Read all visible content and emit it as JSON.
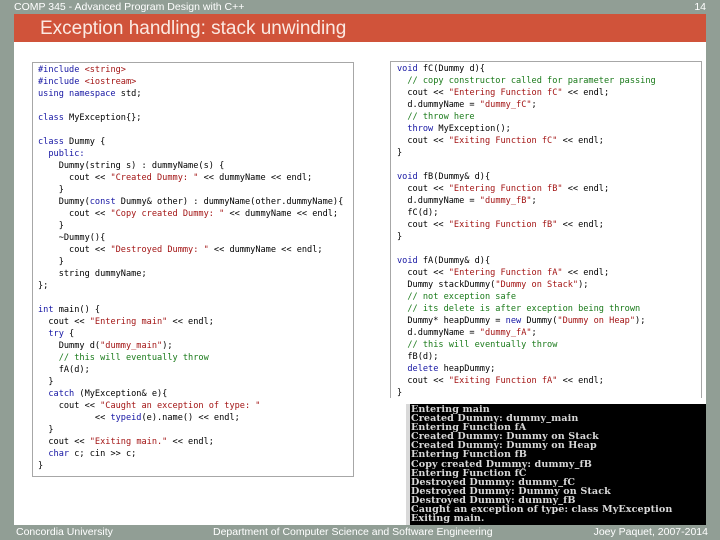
{
  "header": {
    "course_title": "COMP 345 - Advanced Program Design with C++",
    "slide_number": "14",
    "slide_title": "Exception handling: stack unwinding"
  },
  "colors": {
    "frame": "#919e95",
    "title_bar": "#d0533a",
    "keyword": "#1515a3",
    "string": "#a31515",
    "comment": "#1a7a1a",
    "terminal_bg": "#000000"
  },
  "left_code": {
    "lines": [
      [
        {
          "t": "#include ",
          "c": "pp"
        },
        {
          "t": "<string>",
          "c": "str"
        }
      ],
      [
        {
          "t": "#include ",
          "c": "pp"
        },
        {
          "t": "<iostream>",
          "c": "str"
        }
      ],
      [
        {
          "t": "using namespace ",
          "c": "kw"
        },
        {
          "t": "std;",
          "c": ""
        }
      ],
      [],
      [
        {
          "t": "class ",
          "c": "kw"
        },
        {
          "t": "MyException{};",
          "c": ""
        }
      ],
      [],
      [
        {
          "t": "class ",
          "c": "kw"
        },
        {
          "t": "Dummy {",
          "c": ""
        }
      ],
      [
        {
          "t": "  public:",
          "c": "kw"
        }
      ],
      [
        {
          "t": "    Dummy(string s) : dummyName(s) {",
          "c": ""
        }
      ],
      [
        {
          "t": "      cout << ",
          "c": ""
        },
        {
          "t": "\"Created Dummy: \"",
          "c": "str"
        },
        {
          "t": " << dummyName << endl;",
          "c": ""
        }
      ],
      [
        {
          "t": "    }",
          "c": ""
        }
      ],
      [
        {
          "t": "    Dummy(",
          "c": ""
        },
        {
          "t": "const",
          "c": "kw"
        },
        {
          "t": " Dummy& other) : dummyName(other.dummyName){",
          "c": ""
        }
      ],
      [
        {
          "t": "      cout << ",
          "c": ""
        },
        {
          "t": "\"Copy created Dummy: \"",
          "c": "str"
        },
        {
          "t": " << dummyName << endl;",
          "c": ""
        }
      ],
      [
        {
          "t": "    }",
          "c": ""
        }
      ],
      [
        {
          "t": "    ~Dummy(){",
          "c": ""
        }
      ],
      [
        {
          "t": "      cout << ",
          "c": ""
        },
        {
          "t": "\"Destroyed Dummy: \"",
          "c": "str"
        },
        {
          "t": " << dummyName << endl;",
          "c": ""
        }
      ],
      [
        {
          "t": "    }",
          "c": ""
        }
      ],
      [
        {
          "t": "    string dummyName;",
          "c": ""
        }
      ],
      [
        {
          "t": "};",
          "c": ""
        }
      ],
      [],
      [
        {
          "t": "int",
          "c": "kw"
        },
        {
          "t": " main() {",
          "c": ""
        }
      ],
      [
        {
          "t": "  cout << ",
          "c": ""
        },
        {
          "t": "\"Entering main\"",
          "c": "str"
        },
        {
          "t": " << endl;",
          "c": ""
        }
      ],
      [
        {
          "t": "  try",
          "c": "kw"
        },
        {
          "t": " {",
          "c": ""
        }
      ],
      [
        {
          "t": "    Dummy d(",
          "c": ""
        },
        {
          "t": "\"dummy_main\"",
          "c": "str"
        },
        {
          "t": ");",
          "c": ""
        }
      ],
      [
        {
          "t": "    // this will eventually throw",
          "c": "cm"
        }
      ],
      [
        {
          "t": "    fA(d);",
          "c": ""
        }
      ],
      [
        {
          "t": "  }",
          "c": ""
        }
      ],
      [
        {
          "t": "  catch",
          "c": "kw"
        },
        {
          "t": " (MyException& e){",
          "c": ""
        }
      ],
      [
        {
          "t": "    cout << ",
          "c": ""
        },
        {
          "t": "\"Caught an exception of type: \"",
          "c": "str"
        }
      ],
      [
        {
          "t": "           << ",
          "c": ""
        },
        {
          "t": "typeid",
          "c": "kw"
        },
        {
          "t": "(e).name() << endl;",
          "c": ""
        }
      ],
      [
        {
          "t": "  }",
          "c": ""
        }
      ],
      [
        {
          "t": "  cout << ",
          "c": ""
        },
        {
          "t": "\"Exiting main.\"",
          "c": "str"
        },
        {
          "t": " << endl;",
          "c": ""
        }
      ],
      [
        {
          "t": "  char",
          "c": "kw"
        },
        {
          "t": " c; cin >> c;",
          "c": ""
        }
      ],
      [
        {
          "t": "}",
          "c": ""
        }
      ]
    ]
  },
  "right_code": {
    "lines": [
      [
        {
          "t": "void",
          "c": "kw"
        },
        {
          "t": " fC(Dummy d){",
          "c": ""
        }
      ],
      [
        {
          "t": "  // copy constructor called for parameter passing",
          "c": "cm"
        }
      ],
      [
        {
          "t": "  cout << ",
          "c": ""
        },
        {
          "t": "\"Entering Function fC\"",
          "c": "str"
        },
        {
          "t": " << endl;",
          "c": ""
        }
      ],
      [
        {
          "t": "  d.dummyName = ",
          "c": ""
        },
        {
          "t": "\"dummy_fC\"",
          "c": "str"
        },
        {
          "t": ";",
          "c": ""
        }
      ],
      [
        {
          "t": "  // throw here",
          "c": "cm"
        }
      ],
      [
        {
          "t": "  throw",
          "c": "kw"
        },
        {
          "t": " MyException();",
          "c": ""
        }
      ],
      [
        {
          "t": "  cout << ",
          "c": ""
        },
        {
          "t": "\"Exiting Function fC\"",
          "c": "str"
        },
        {
          "t": " << endl;",
          "c": ""
        }
      ],
      [
        {
          "t": "}",
          "c": ""
        }
      ],
      [],
      [
        {
          "t": "void",
          "c": "kw"
        },
        {
          "t": " fB(Dummy& d){",
          "c": ""
        }
      ],
      [
        {
          "t": "  cout << ",
          "c": ""
        },
        {
          "t": "\"Entering Function fB\"",
          "c": "str"
        },
        {
          "t": " << endl;",
          "c": ""
        }
      ],
      [
        {
          "t": "  d.dummyName = ",
          "c": ""
        },
        {
          "t": "\"dummy_fB\"",
          "c": "str"
        },
        {
          "t": ";",
          "c": ""
        }
      ],
      [
        {
          "t": "  fC(d);",
          "c": ""
        }
      ],
      [
        {
          "t": "  cout << ",
          "c": ""
        },
        {
          "t": "\"Exiting Function fB\"",
          "c": "str"
        },
        {
          "t": " << endl;",
          "c": ""
        }
      ],
      [
        {
          "t": "}",
          "c": ""
        }
      ],
      [],
      [
        {
          "t": "void",
          "c": "kw"
        },
        {
          "t": " fA(Dummy& d){",
          "c": ""
        }
      ],
      [
        {
          "t": "  cout << ",
          "c": ""
        },
        {
          "t": "\"Entering Function fA\"",
          "c": "str"
        },
        {
          "t": " << endl;",
          "c": ""
        }
      ],
      [
        {
          "t": "  Dummy stackDummy(",
          "c": ""
        },
        {
          "t": "\"Dummy on Stack\"",
          "c": "str"
        },
        {
          "t": ");",
          "c": ""
        }
      ],
      [
        {
          "t": "  // not exception safe",
          "c": "cm"
        }
      ],
      [
        {
          "t": "  // its delete is after exception being thrown",
          "c": "cm"
        }
      ],
      [
        {
          "t": "  Dummy* heapDummy = ",
          "c": ""
        },
        {
          "t": "new",
          "c": "kw"
        },
        {
          "t": " Dummy(",
          "c": ""
        },
        {
          "t": "\"Dummy on Heap\"",
          "c": "str"
        },
        {
          "t": ");",
          "c": ""
        }
      ],
      [
        {
          "t": "  d.dummyName = ",
          "c": ""
        },
        {
          "t": "\"dummy_fA\"",
          "c": "str"
        },
        {
          "t": ";",
          "c": ""
        }
      ],
      [
        {
          "t": "  // this will eventually throw",
          "c": "cm"
        }
      ],
      [
        {
          "t": "  fB(d);",
          "c": ""
        }
      ],
      [
        {
          "t": "  delete",
          "c": "kw"
        },
        {
          "t": " heapDummy;",
          "c": ""
        }
      ],
      [
        {
          "t": "  cout << ",
          "c": ""
        },
        {
          "t": "\"Exiting Function fA\"",
          "c": "str"
        },
        {
          "t": " << endl;",
          "c": ""
        }
      ],
      [
        {
          "t": "}",
          "c": ""
        }
      ]
    ]
  },
  "terminal": {
    "output": [
      "Entering main",
      "Created Dummy: dummy_main",
      "Entering Function fA",
      "Created Dummy: Dummy on Stack",
      "Created Dummy: Dummy on Heap",
      "Entering Function fB",
      "Copy created Dummy: dummy_fB",
      "Entering Function fC",
      "Destroyed Dummy: dummy_fC",
      "Destroyed Dummy: Dummy on Stack",
      "Destroyed Dummy: dummy_fB",
      "Caught an exception of type: class MyException",
      "Exiting main."
    ]
  },
  "footer": {
    "left": "Concordia University",
    "center": "Department of Computer Science and Software Engineering",
    "right": "Joey Paquet, 2007-2014"
  }
}
